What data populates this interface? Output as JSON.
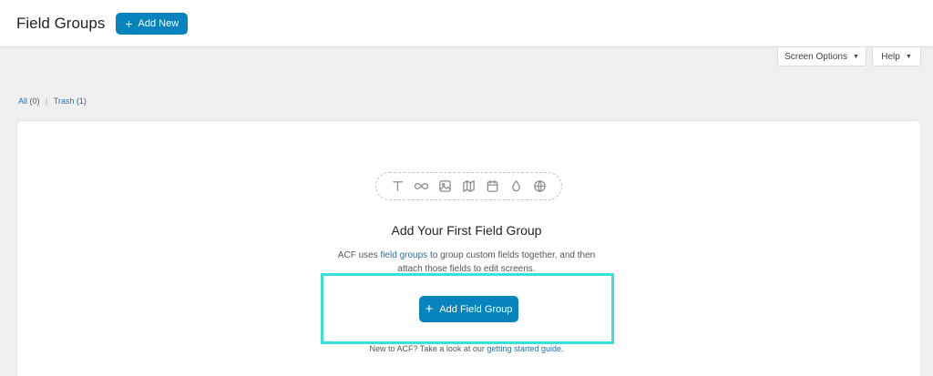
{
  "header": {
    "title": "Field Groups",
    "add_new_label": "Add New"
  },
  "screen_meta": {
    "screen_options_label": "Screen Options",
    "help_label": "Help"
  },
  "views": [
    {
      "label": "All",
      "count": "(0)"
    },
    {
      "label": "Trash",
      "count": "(1)"
    }
  ],
  "empty_state": {
    "icons": [
      "text-icon",
      "infinity-icon",
      "image-icon",
      "map-icon",
      "calendar-icon",
      "droplet-icon",
      "globe-icon"
    ],
    "title": "Add Your First Field Group",
    "desc_before": "ACF uses",
    "desc_link": "field groups",
    "desc_after": "to group custom fields together, and then attach those fields to edit screens.",
    "button_label": "Add Field Group",
    "footer_before": "New to ACF? Take a look at our",
    "footer_link": "getting started guide."
  },
  "colors": {
    "primary": "#0783be",
    "highlight": "#38e0dc",
    "link": "#2271b1"
  }
}
